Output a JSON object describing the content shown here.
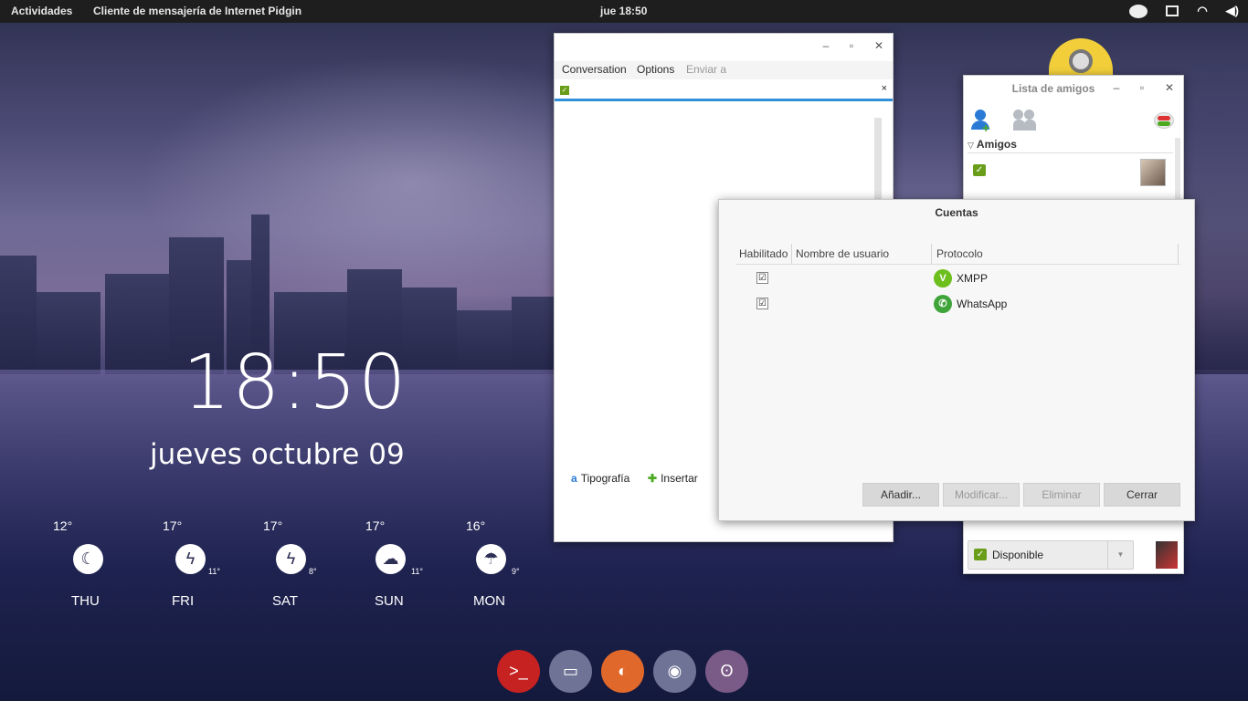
{
  "topbar": {
    "activities": "Actividades",
    "app_menu": "Cliente de mensajería de Internet Pidgin",
    "clock": "jue 18:50",
    "tray_icons": [
      "chat-icon",
      "image-icon",
      "wifi-icon",
      "volume-icon"
    ]
  },
  "desklet": {
    "time": "18:50",
    "date": "jueves octubre 09",
    "forecast": [
      {
        "day": "THU",
        "high": "12°",
        "low": "",
        "icon": "moon-icon"
      },
      {
        "day": "FRI",
        "high": "17°",
        "low": "11°",
        "icon": "storm-icon"
      },
      {
        "day": "SAT",
        "high": "17°",
        "low": "8°",
        "icon": "storm-icon"
      },
      {
        "day": "SUN",
        "high": "17°",
        "low": "11°",
        "icon": "sun-cloud-icon"
      },
      {
        "day": "MON",
        "high": "16°",
        "low": "9°",
        "icon": "rain-icon"
      }
    ]
  },
  "conversation": {
    "menu": {
      "conversation": "Conversation",
      "options": "Options",
      "send_to": "Enviar a"
    },
    "tab_close": "×",
    "toolbar": {
      "font": "Tipografía",
      "insert": "Insertar"
    }
  },
  "buddy_list": {
    "title": "Lista de amigos",
    "group": "Amigos",
    "status": "Disponible"
  },
  "accounts": {
    "title": "Cuentas",
    "columns": {
      "enabled": "Habilitado",
      "username": "Nombre de usuario",
      "protocol": "Protocolo"
    },
    "rows": [
      {
        "enabled": "☑",
        "protocol": "XMPP",
        "color": "#6cbf1c"
      },
      {
        "enabled": "☑",
        "protocol": "WhatsApp",
        "color": "#3fa53a"
      }
    ],
    "buttons": {
      "add": "Añadir...",
      "modify": "Modificar...",
      "delete": "Eliminar",
      "close": "Cerrar"
    }
  },
  "dock": [
    "terminal-icon",
    "files-icon",
    "firefox-icon",
    "chromium-icon",
    "pidgin-icon"
  ],
  "window_controls": {
    "minimize": "–",
    "maximize": "▫",
    "close": "✕"
  }
}
